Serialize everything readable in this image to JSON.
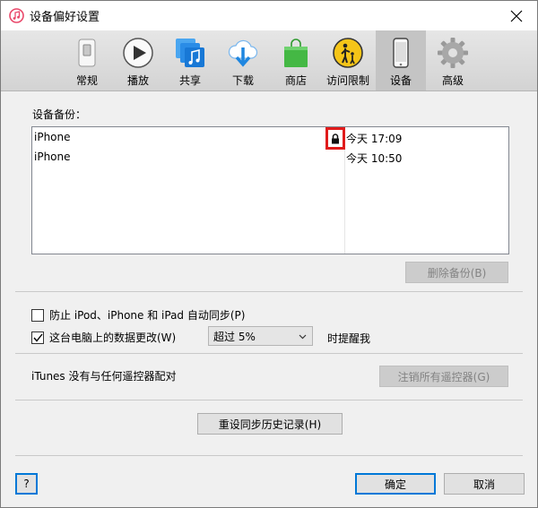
{
  "window": {
    "title": "设备偏好设置"
  },
  "toolbar": {
    "items": [
      {
        "label": "常规",
        "icon": "switch-icon"
      },
      {
        "label": "播放",
        "icon": "play-icon"
      },
      {
        "label": "共享",
        "icon": "music-share-icon"
      },
      {
        "label": "下载",
        "icon": "cloud-download-icon"
      },
      {
        "label": "商店",
        "icon": "store-bag-icon"
      },
      {
        "label": "访问限制",
        "icon": "parental-controls-icon"
      },
      {
        "label": "设备",
        "icon": "phone-icon",
        "active": true
      },
      {
        "label": "高级",
        "icon": "gear-icon"
      }
    ]
  },
  "backups": {
    "label": "设备备份：",
    "rows": [
      {
        "name": "iPhone",
        "date": "今天 17:09",
        "locked": true
      },
      {
        "name": "iPhone",
        "date": "今天 10:50",
        "locked": false
      }
    ],
    "delete_button": "删除备份(B)"
  },
  "options": {
    "prevent_sync_label": "防止 iPod、iPhone 和 iPad 自动同步(P)",
    "prevent_sync_checked": false,
    "warn_label": "这台电脑上的数据更改(W)",
    "warn_checked": true,
    "threshold_value": "超过 5%",
    "warn_suffix": "时提醒我"
  },
  "remotes": {
    "status": "iTunes 没有与任何遥控器配对",
    "forget_button": "注销所有遥控器(G)"
  },
  "reset_button": "重设同步历史记录(H)",
  "footer": {
    "help": "?",
    "ok": "确定",
    "cancel": "取消"
  },
  "colors": {
    "highlight": "#e01b1b",
    "accent": "#0078d7"
  }
}
